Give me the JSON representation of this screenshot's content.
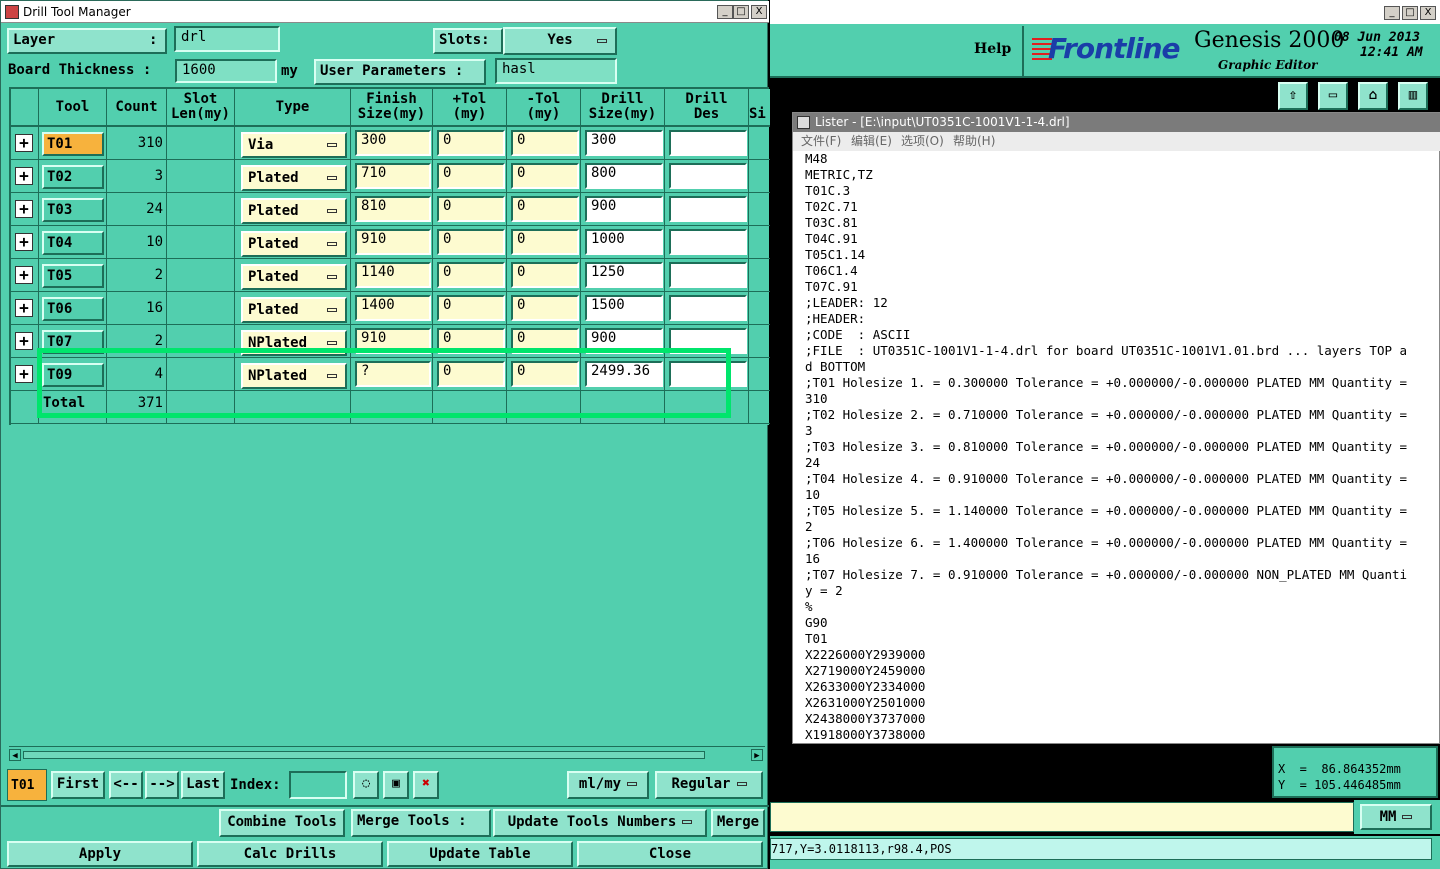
{
  "left_window": {
    "title": "Drill Tool Manager",
    "controls": {
      "min": "_",
      "max": "□",
      "close": "X"
    },
    "layer_label": "Layer",
    "layer_colon": ":",
    "layer_value": "drl",
    "slots_label": "Slots:",
    "slots_value": "Yes",
    "board_thickness_label": "Board Thickness :",
    "board_thickness_value": "1600",
    "board_thickness_unit": "my",
    "user_params_label": "User Parameters :",
    "user_params_value": "hasl",
    "columns": [
      "Tool",
      "Count",
      "Slot Len(my)",
      "Type",
      "Finish Size(my)",
      "+Tol (my)",
      "-Tol (my)",
      "Drill Size(my)",
      "Drill Des",
      "Si"
    ],
    "col_lines": {
      "slot1": "Slot",
      "slot2": "Len(my)",
      "fin1": "Finish",
      "fin2": "Size(my)",
      "ptol1": "+Tol",
      "ptol2": "(my)",
      "mtol1": "-Tol",
      "mtol2": "(my)",
      "dsz1": "Drill",
      "dsz2": "Size(my)",
      "dd1": "Drill",
      "dd2": "Des"
    },
    "rows": [
      {
        "tool": "T01",
        "count": "310",
        "type": "Via",
        "finish": "300",
        "ptol": "0",
        "mtol": "0",
        "drill": "300",
        "des": ""
      },
      {
        "tool": "T02",
        "count": "3",
        "type": "Plated",
        "finish": "710",
        "ptol": "0",
        "mtol": "0",
        "drill": "800",
        "des": ""
      },
      {
        "tool": "T03",
        "count": "24",
        "type": "Plated",
        "finish": "810",
        "ptol": "0",
        "mtol": "0",
        "drill": "900",
        "des": ""
      },
      {
        "tool": "T04",
        "count": "10",
        "type": "Plated",
        "finish": "910",
        "ptol": "0",
        "mtol": "0",
        "drill": "1000",
        "des": ""
      },
      {
        "tool": "T05",
        "count": "2",
        "type": "Plated",
        "finish": "1140",
        "ptol": "0",
        "mtol": "0",
        "drill": "1250",
        "des": ""
      },
      {
        "tool": "T06",
        "count": "16",
        "type": "Plated",
        "finish": "1400",
        "ptol": "0",
        "mtol": "0",
        "drill": "1500",
        "des": ""
      },
      {
        "tool": "T07",
        "count": "2",
        "type": "NPlated",
        "finish": "910",
        "ptol": "0",
        "mtol": "0",
        "drill": "900",
        "des": ""
      },
      {
        "tool": "T09",
        "count": "4",
        "type": "NPlated",
        "finish": "?",
        "ptol": "0",
        "mtol": "0",
        "drill": "2499.36",
        "des": ""
      }
    ],
    "total_label": "Total",
    "total_count": "371",
    "current_tool": "T01",
    "nav": {
      "first": "First",
      "prev": "<--",
      "next": "-->",
      "last": "Last",
      "index": "Index:"
    },
    "units": "ml/my",
    "mode": "Regular",
    "combine": "Combine Tools",
    "merge_tools": "Merge Tools :",
    "update_numbers": "Update Tools Numbers",
    "merge": "Merge",
    "apply": "Apply",
    "calc": "Calc Drills",
    "update_table": "Update Table",
    "close": "Close"
  },
  "right_window": {
    "help": "Help",
    "brand": "Frontline",
    "product": "Genesis 2000",
    "subtitle": "Graphic Editor",
    "date": "08 Jun 2013",
    "time": "12:41 AM",
    "x_readout": "X  =  86.864352mm",
    "y_readout": "Y  = 105.446485mm",
    "unit": "MM",
    "status_line": "717,Y=3.0118113,r98.4,POS"
  },
  "lister": {
    "title": "Lister - [E:\\input\\UT0351C-1001V1-1-4.drl]",
    "menu": [
      "文件(F)",
      "编辑(E)",
      "选项(O)",
      "帮助(H)"
    ],
    "lines": [
      "M48",
      "METRIC,TZ",
      "T01C.3",
      "T02C.71",
      "T03C.81",
      "T04C.91",
      "T05C1.14",
      "T06C1.4",
      "T07C.91",
      ";LEADER: 12",
      ";HEADER:",
      ";CODE  : ASCII",
      ";FILE  : UT0351C-1001V1-1-4.drl for board UT0351C-1001V1.01.brd ... layers TOP a",
      "d BOTTOM",
      ";T01 Holesize 1. = 0.300000 Tolerance = +0.000000/-0.000000 PLATED MM Quantity =",
      "310",
      ";T02 Holesize 2. = 0.710000 Tolerance = +0.000000/-0.000000 PLATED MM Quantity =",
      "3",
      ";T03 Holesize 3. = 0.810000 Tolerance = +0.000000/-0.000000 PLATED MM Quantity =",
      "24",
      ";T04 Holesize 4. = 0.910000 Tolerance = +0.000000/-0.000000 PLATED MM Quantity =",
      "10",
      ";T05 Holesize 5. = 1.140000 Tolerance = +0.000000/-0.000000 PLATED MM Quantity =",
      "2",
      ";T06 Holesize 6. = 1.400000 Tolerance = +0.000000/-0.000000 PLATED MM Quantity =",
      "16",
      ";T07 Holesize 7. = 0.910000 Tolerance = +0.000000/-0.000000 NON_PLATED MM Quanti",
      "y = 2",
      "%",
      "G90",
      "T01",
      "X2226000Y2939000",
      "X2719000Y2459000",
      "X2633000Y2334000",
      "X2631000Y2501000",
      "X2438000Y3737000",
      "X1918000Y3738000"
    ]
  }
}
